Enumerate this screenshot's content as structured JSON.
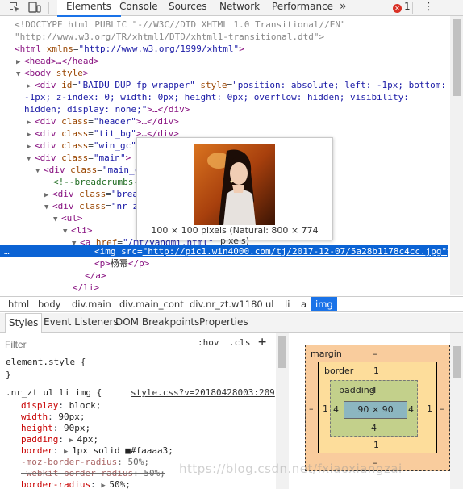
{
  "tabbar": {
    "tabs": [
      "Elements",
      "Console",
      "Sources",
      "Network",
      "Performance"
    ],
    "more": "»",
    "error_count": "1",
    "error_glyph": "✕",
    "menu": "⋮"
  },
  "dom": {
    "doctype": "<!DOCTYPE html PUBLIC \"-//W3C//DTD XHTML 1.0 Transitional//EN\"",
    "doctype2": "\"http://www.w3.org/TR/xhtml1/DTD/xhtml1-transitional.dtd\">",
    "html_open": "<html",
    "xmlns_attr": "xmlns",
    "xmlns_val": "\"http://www.w3.org/1999/xhtml\"",
    "gt": ">",
    "head": "<head>…</head>",
    "body_open": "<body",
    "style_attr": "style",
    "wrapper_id_attr": "id",
    "wrapper_id": "\"BAIDU_DUP_fp_wrapper\"",
    "wrapper_style_attr": "style",
    "wrapper_style": "\"position: absolute; left: -1px; bottom:",
    "wrapper_style2": "-1px; z-index: 0; width: 0px; height: 0px; overflow: hidden; visibility:",
    "wrapper_style3": "hidden; display: none;\"",
    "wrapper_close": ">…</div>",
    "div_open": "<div",
    "class_attr": "class",
    "header_cls": "\"header\"",
    "tit_cls": "\"tit_bg\"",
    "win_cls": "\"win_gc\"",
    "main_cls": "\"main\"",
    "main_c_cls": "\"main_c",
    "collapsed": ">…</div>",
    "comment": "<!--breadcrumbs-",
    "brea_cls": "\"brea",
    "nr_cls": "\"nr_z",
    "ul": "<ul>",
    "li": "<li>",
    "a_open": "<a",
    "href_attr": "href",
    "href_val": "\"/mt/yangmi.html\"",
    "img_open": "<img",
    "src_attr": "src",
    "src_val": "\"http://pic1.win4000.com/tj/2017-12-07/5a28b1178c4cc.jpg\"",
    "img_close": ">",
    "p_open": "<p>",
    "p_text": "杨幂",
    "p_close": "</p>",
    "a_close": "</a>",
    "li_close": "</li>",
    "ellipsis": "…"
  },
  "tooltip": {
    "caption": "100 × 100 pixels (Natural: 800 × 774 pixels)"
  },
  "breadcrumb": [
    "html",
    "body",
    "div.main",
    "div.main_cont",
    "div.nr_zt.w1180",
    "ul",
    "li",
    "a",
    "img"
  ],
  "subtabs": [
    "Styles",
    "Event Listeners",
    "DOM Breakpoints",
    "Properties"
  ],
  "styles": {
    "filter_placeholder": "Filter",
    "hov": ":hov",
    "cls": ".cls",
    "plus": "+",
    "element_style": "element.style {",
    "close_brace": "}",
    "selector": ".nr_zt ul li img {",
    "source": "style.css?v=20180428003:209",
    "props": [
      {
        "name": "display",
        "value": "block;",
        "strike": false,
        "expand": false
      },
      {
        "name": "width",
        "value": "90px;",
        "strike": false,
        "expand": false
      },
      {
        "name": "height",
        "value": "90px;",
        "strike": false,
        "expand": false
      },
      {
        "name": "padding",
        "value": "4px;",
        "strike": false,
        "expand": true
      },
      {
        "name": "border",
        "value": "1px solid ■#faaaa3;",
        "strike": false,
        "expand": true
      },
      {
        "name": "-moz-border-radius",
        "value": "50%;",
        "strike": true,
        "expand": false
      },
      {
        "name": "-webkit-border-radius",
        "value": "50%;",
        "strike": true,
        "expand": false
      },
      {
        "name": "border-radius",
        "value": "50%;",
        "strike": false,
        "expand": true
      }
    ],
    "swatch_color": "#faaaa3"
  },
  "boxmodel": {
    "margin_label": "margin",
    "margin_top": "–",
    "margin_bottom": "–",
    "margin_left": "–",
    "margin_right": "–",
    "border_label": "border",
    "border_top": "1",
    "border_bottom": "1",
    "border_left": "1",
    "border_right": "1",
    "padding_label": "padding",
    "padding_top": "4",
    "padding_bottom": "4",
    "padding_left": "4",
    "padding_right": "4",
    "content": "90 × 90",
    "colors": {
      "margin": "#f9cc9d",
      "border": "#fddd9b",
      "padding": "#c3d08b",
      "content": "#8cb6c0"
    }
  },
  "watermark": "https://blog.csdn.net/fxiaoxiangzai"
}
